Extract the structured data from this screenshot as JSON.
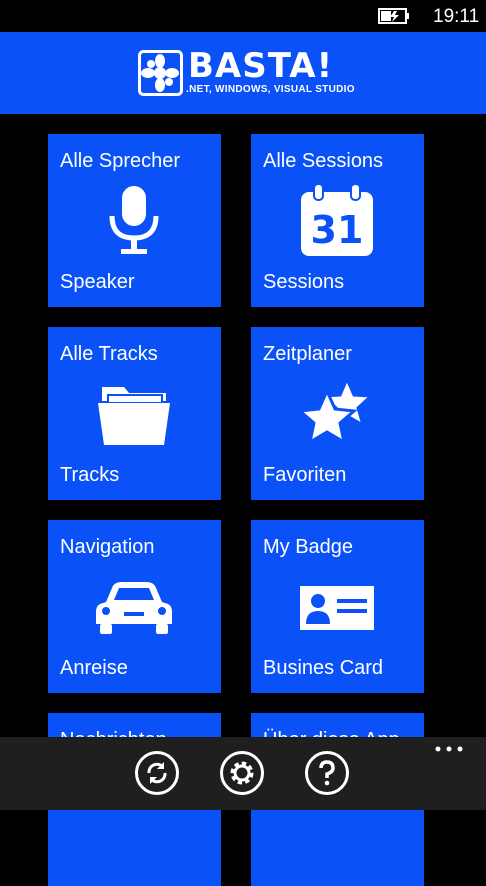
{
  "status": {
    "time": "19:11",
    "battery_icon": "battery-charging-icon"
  },
  "header": {
    "logo_text": "BASTA!",
    "logo_subtitle": ".NET, WINDOWS, VISUAL STUDIO",
    "background": "#0a52f7"
  },
  "tiles": [
    {
      "title": "Alle Sprecher",
      "label": "Speaker",
      "icon": "microphone-icon"
    },
    {
      "title": "Alle Sessions",
      "label": "Sessions",
      "icon": "calendar-icon",
      "icon_text": "31"
    },
    {
      "title": "Alle Tracks",
      "label": "Tracks",
      "icon": "folder-icon"
    },
    {
      "title": "Zeitplaner",
      "label": "Favoriten",
      "icon": "stars-icon"
    },
    {
      "title": "Navigation",
      "label": "Anreise",
      "icon": "car-icon"
    },
    {
      "title": "My Badge",
      "label": "Busines Card",
      "icon": "business-card-icon"
    },
    {
      "title": "Nachrichten",
      "label": "",
      "icon": ""
    },
    {
      "title": "Über diese App",
      "label": "",
      "icon": ""
    }
  ],
  "appbar": {
    "buttons": [
      "refresh-icon",
      "settings-icon",
      "help-icon"
    ],
    "more": "more-icon"
  }
}
